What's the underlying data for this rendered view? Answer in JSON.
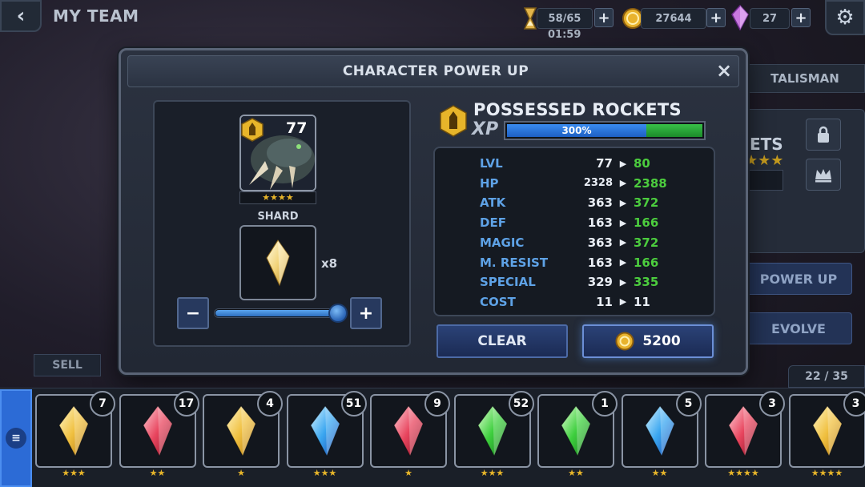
{
  "topbar": {
    "title": "MY TEAM",
    "energy": "58/65",
    "timer": "01:59",
    "gold": "27644",
    "gems": "27"
  },
  "background": {
    "tab_talisman": "TALISMAN",
    "char_name_fragment": "ETS",
    "power_up_label": "POWER UP",
    "evolve_label": "EVOLVE",
    "sell_label": "SELL",
    "inventory_count": "22 / 35"
  },
  "modal": {
    "title": "CHARACTER POWER UP",
    "close_icon": "×",
    "character": {
      "level": "77",
      "stars": "★★★★"
    },
    "shard_label": "SHARD",
    "shard_qty": "x8",
    "slider_value": 1.0,
    "name": "POSSESSED ROCKETS",
    "xp_label": "XP",
    "xp_percent": "300%",
    "stats": [
      {
        "name": "LVL",
        "current": "77",
        "new": "80"
      },
      {
        "name": "HP",
        "current": "2328",
        "new": "2388"
      },
      {
        "name": "ATK",
        "current": "363",
        "new": "372"
      },
      {
        "name": "DEF",
        "current": "163",
        "new": "166"
      },
      {
        "name": "MAGIC",
        "current": "363",
        "new": "372"
      },
      {
        "name": "M. RESIST",
        "current": "163",
        "new": "166"
      },
      {
        "name": "SPECIAL",
        "current": "329",
        "new": "335"
      },
      {
        "name": "COST",
        "current": "11",
        "new": "11"
      }
    ],
    "clear_label": "CLEAR",
    "cost_value": "5200"
  },
  "inventory": [
    {
      "count": "7",
      "stars": "★★★",
      "color": "gold"
    },
    {
      "count": "17",
      "stars": "★★",
      "color": "red"
    },
    {
      "count": "4",
      "stars": "★",
      "color": "gold"
    },
    {
      "count": "51",
      "stars": "★★★",
      "color": "blue"
    },
    {
      "count": "9",
      "stars": "★",
      "color": "red"
    },
    {
      "count": "52",
      "stars": "★★★",
      "color": "green"
    },
    {
      "count": "1",
      "stars": "★★",
      "color": "green"
    },
    {
      "count": "5",
      "stars": "★★",
      "color": "blue"
    },
    {
      "count": "3",
      "stars": "★★★★",
      "color": "red"
    },
    {
      "count": "3",
      "stars": "★★★★",
      "color": "gold"
    }
  ],
  "colors": {
    "stat_name": "#5ea2e6",
    "stat_increase": "#4ccd3e",
    "button_blue": "#2b4277",
    "star_gold": "#e7b52a"
  },
  "icons": {
    "back": "chevron-left-icon",
    "energy": "hourglass-icon",
    "gold": "coin-icon",
    "gems": "crystal-icon",
    "settings": "gear-icon",
    "lock": "lock-icon",
    "crown": "crown-icon",
    "menu": "menu-icon"
  }
}
